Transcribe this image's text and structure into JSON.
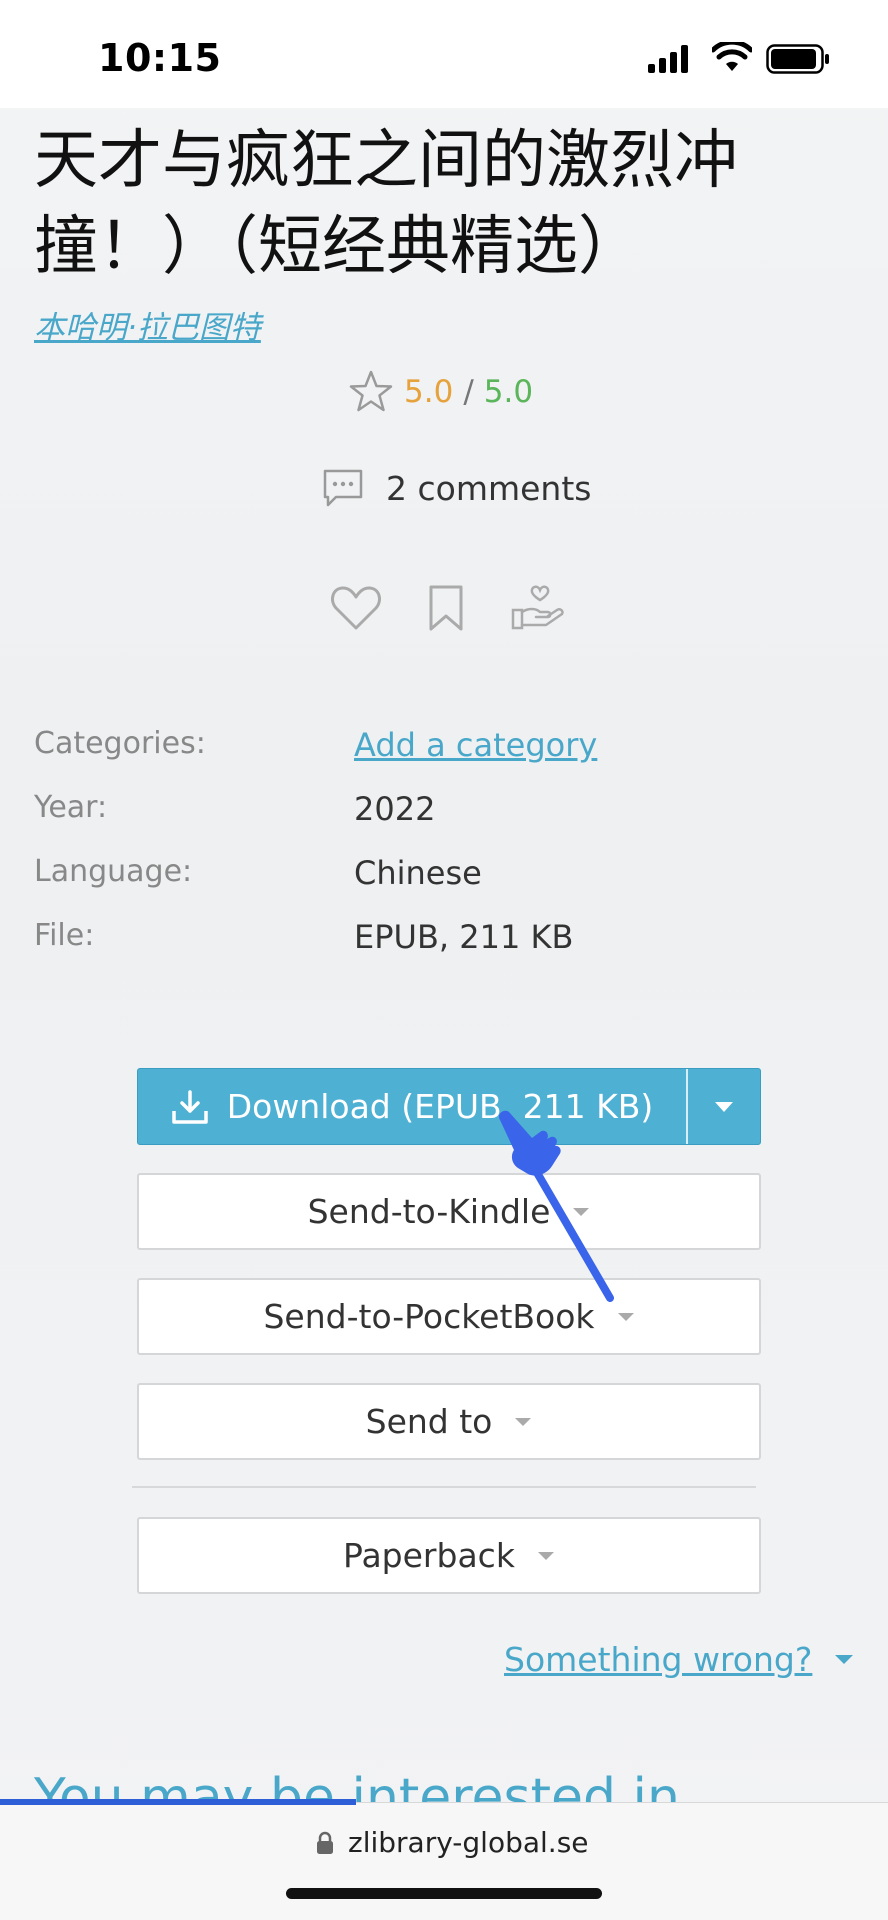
{
  "status_bar": {
    "time": "10:15"
  },
  "book": {
    "title": "天才与疯狂之间的激烈冲撞！）（短经典精选）",
    "author": "本哈明·拉巴图特",
    "rating": {
      "value": "5.0",
      "separator": "/",
      "max": "5.0"
    },
    "comments": "2 comments"
  },
  "details": [
    {
      "label": "Categories:",
      "value": "Add a category",
      "link": true
    },
    {
      "label": "Year:",
      "value": "2022",
      "link": false
    },
    {
      "label": "Language:",
      "value": "Chinese",
      "link": false
    },
    {
      "label": "File:",
      "value": "EPUB, 211 KB",
      "link": false
    }
  ],
  "buttons": {
    "download": "Download (EPUB, 211 KB)",
    "send_kindle": "Send-to-Kindle",
    "send_pocketbook": "Send-to-PocketBook",
    "send_to": "Send to",
    "paperback": "Paperback"
  },
  "links": {
    "something_wrong": "Something wrong?",
    "interested": "You may be interested in"
  },
  "browser": {
    "url": "zlibrary-global.se"
  },
  "colors": {
    "accent": "#4eb0d2",
    "link": "#49a7c9",
    "rating": "#e6a23c",
    "rating_max": "#5bb55b"
  }
}
